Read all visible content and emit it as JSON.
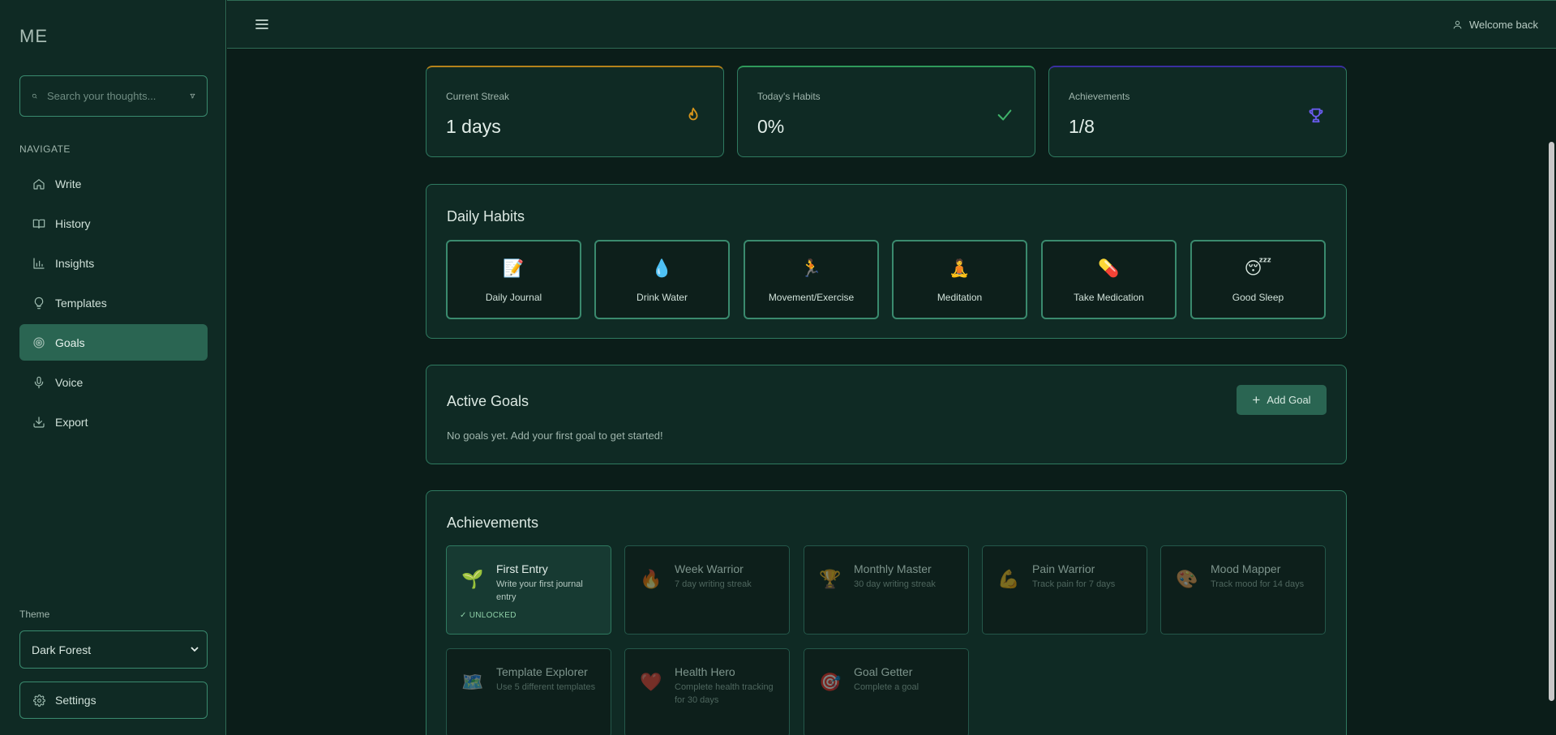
{
  "sidebar": {
    "brand": "ME",
    "search_placeholder": "Search your thoughts...",
    "nav_heading": "NAVIGATE",
    "items": [
      {
        "label": "Write",
        "icon": "home-icon"
      },
      {
        "label": "History",
        "icon": "book-icon"
      },
      {
        "label": "Insights",
        "icon": "bar-chart-icon"
      },
      {
        "label": "Templates",
        "icon": "lightbulb-icon"
      },
      {
        "label": "Goals",
        "icon": "target-icon",
        "active": true
      },
      {
        "label": "Voice",
        "icon": "microphone-icon"
      },
      {
        "label": "Export",
        "icon": "download-icon"
      }
    ],
    "theme_label": "Theme",
    "theme_value": "Dark Forest",
    "settings_label": "Settings"
  },
  "topbar": {
    "welcome": "Welcome back"
  },
  "stats": [
    {
      "label": "Current Streak",
      "value": "1 days",
      "icon": "flame-icon",
      "accent": "#b5821a"
    },
    {
      "label": "Today's Habits",
      "value": "0%",
      "icon": "check-icon",
      "accent": "#2f9a5b"
    },
    {
      "label": "Achievements",
      "value": "1/8",
      "icon": "trophy-icon",
      "accent": "#5a4cd6"
    }
  ],
  "habits": {
    "title": "Daily Habits",
    "items": [
      {
        "emoji": "📝",
        "name": "Daily Journal"
      },
      {
        "emoji": "💧",
        "name": "Drink Water"
      },
      {
        "emoji": "🏃",
        "name": "Movement/Exercise"
      },
      {
        "emoji": "🧘",
        "name": "Meditation"
      },
      {
        "emoji": "💊",
        "name": "Take Medication"
      },
      {
        "emoji": "😴",
        "name": "Good Sleep"
      }
    ]
  },
  "goals": {
    "title": "Active Goals",
    "add_label": "Add Goal",
    "empty_text": "No goals yet. Add your first goal to get started!"
  },
  "achievements": {
    "title": "Achievements",
    "unlocked_badge": "✓ UNLOCKED",
    "items": [
      {
        "emoji": "🌱",
        "title": "First Entry",
        "desc": "Write your first journal entry",
        "unlocked": true
      },
      {
        "emoji": "🔥",
        "title": "Week Warrior",
        "desc": "7 day writing streak",
        "unlocked": false
      },
      {
        "emoji": "🏆",
        "title": "Monthly Master",
        "desc": "30 day writing streak",
        "unlocked": false
      },
      {
        "emoji": "💪",
        "title": "Pain Warrior",
        "desc": "Track pain for 7 days",
        "unlocked": false
      },
      {
        "emoji": "🎨",
        "title": "Mood Mapper",
        "desc": "Track mood for 14 days",
        "unlocked": false
      },
      {
        "emoji": "🗺️",
        "title": "Template Explorer",
        "desc": "Use 5 different templates",
        "unlocked": false
      },
      {
        "emoji": "❤️",
        "title": "Health Hero",
        "desc": "Complete health tracking for 30 days",
        "unlocked": false
      },
      {
        "emoji": "🎯",
        "title": "Goal Getter",
        "desc": "Complete a goal",
        "unlocked": false
      }
    ]
  }
}
